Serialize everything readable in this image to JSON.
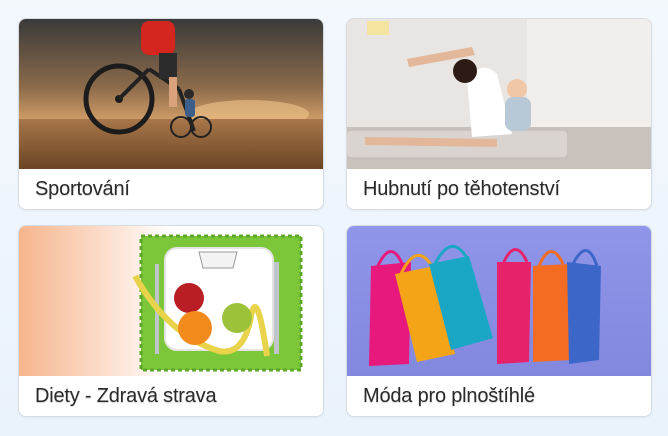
{
  "cards": [
    {
      "title": "Sportování",
      "image": "cyclist-sunset-image"
    },
    {
      "title": "Hubnutí po těhotenství",
      "image": "mother-baby-yoga-image"
    },
    {
      "title": "Diety - Zdravá strava",
      "image": "plate-scale-apple-image"
    },
    {
      "title": "Móda pro plnoštíhlé",
      "image": "shopping-bags-image"
    }
  ]
}
